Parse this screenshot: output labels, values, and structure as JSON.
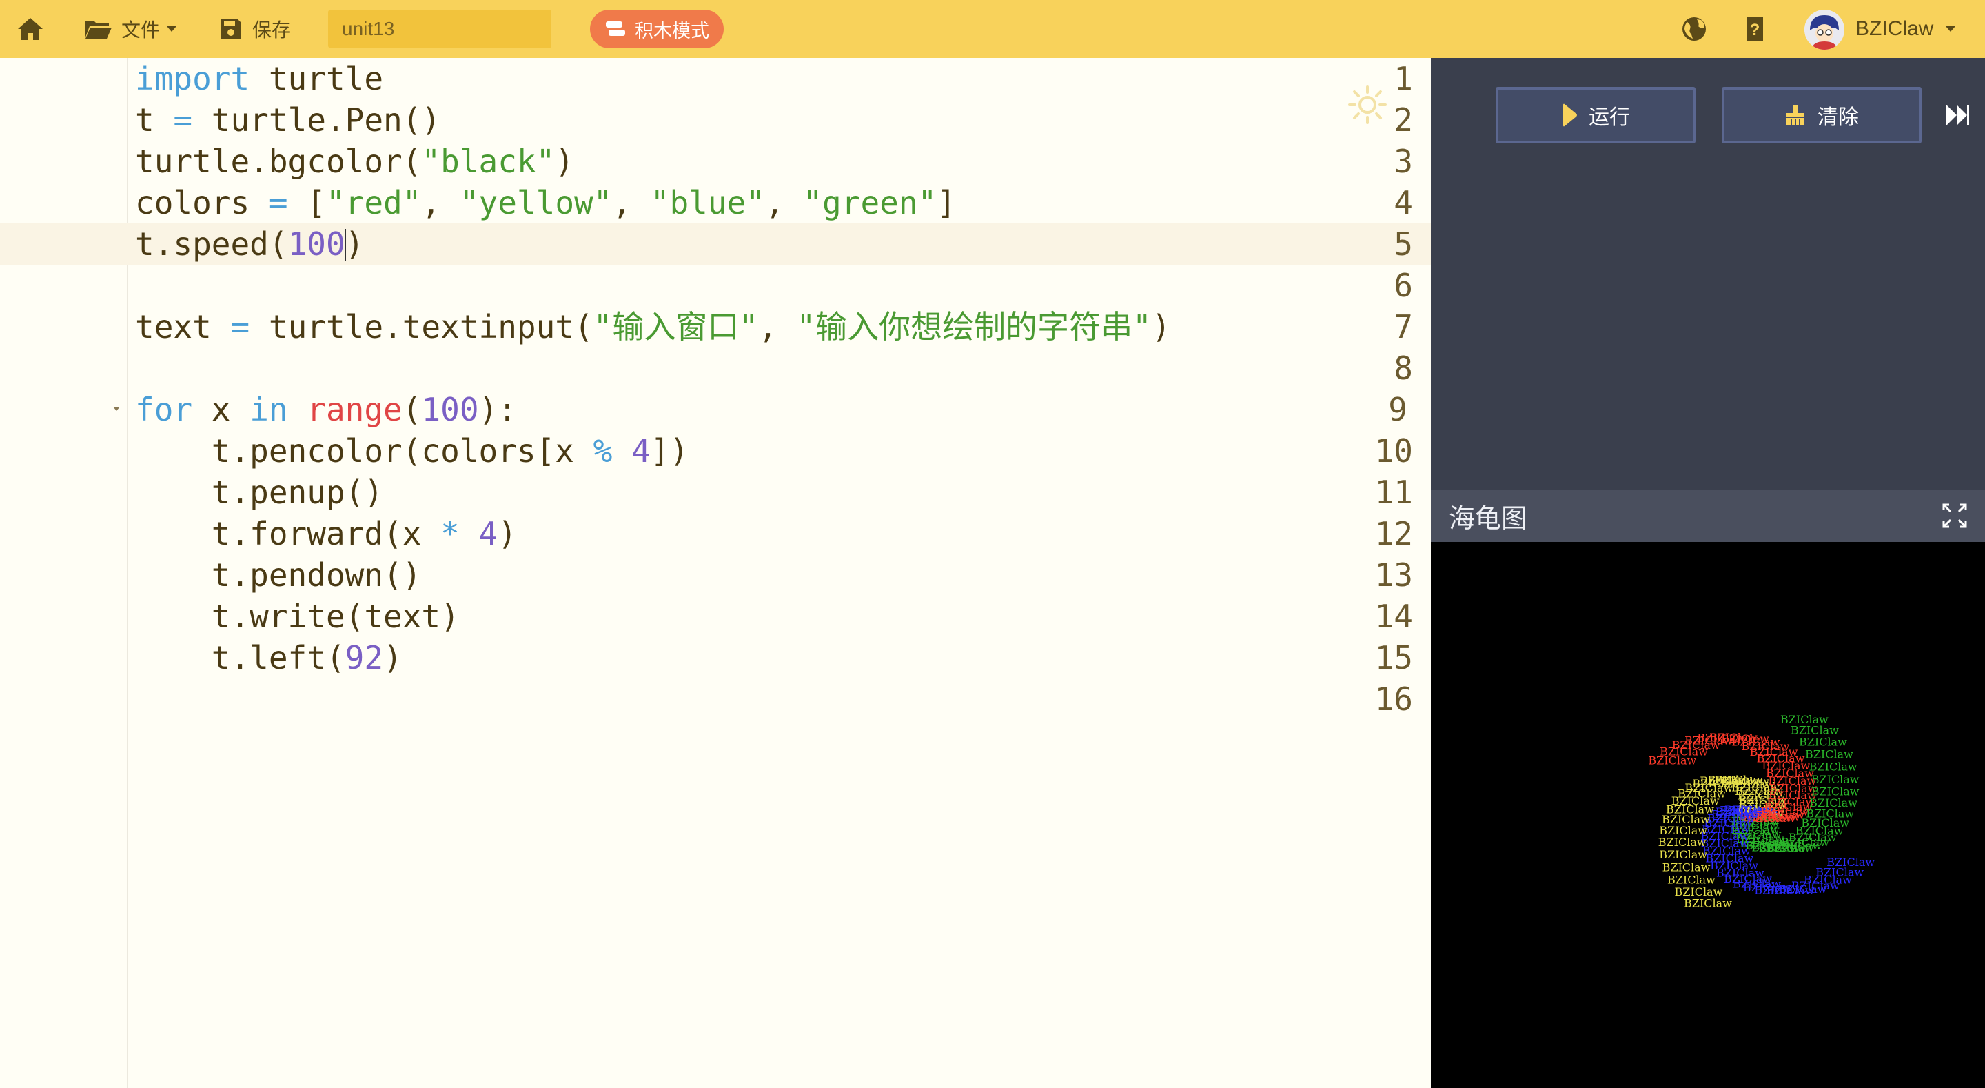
{
  "topbar": {
    "home_icon": "home-icon",
    "file_label": "文件",
    "save_label": "保存",
    "project_name": "unit13",
    "blocks_mode_label": "积木模式",
    "username": "BZIClaw",
    "bg_color": "#f8d25b"
  },
  "editor": {
    "theme_icon": "sun-icon",
    "active_line": 5,
    "lines": [
      {
        "n": "1"
      },
      {
        "n": "2"
      },
      {
        "n": "3"
      },
      {
        "n": "4"
      },
      {
        "n": "5"
      },
      {
        "n": "6"
      },
      {
        "n": "7"
      },
      {
        "n": "8"
      },
      {
        "n": "9"
      },
      {
        "n": "10"
      },
      {
        "n": "11"
      },
      {
        "n": "12"
      },
      {
        "n": "13"
      },
      {
        "n": "14"
      },
      {
        "n": "15"
      },
      {
        "n": "16"
      }
    ],
    "code": {
      "l1_kw": "import",
      "l1_rest": " turtle",
      "l2_a": "t ",
      "l2_op": "=",
      "l2_b": " turtle.Pen()",
      "l3_a": "turtle.bgcolor(",
      "l3_str": "\"black\"",
      "l3_b": ")",
      "l4_a": "colors ",
      "l4_op": "=",
      "l4_b": " [",
      "l4_s1": "\"red\"",
      "l4_c1": ", ",
      "l4_s2": "\"yellow\"",
      "l4_c2": ", ",
      "l4_s3": "\"blue\"",
      "l4_c3": ", ",
      "l4_s4": "\"green\"",
      "l4_e": "]",
      "l5_a": "t.speed(",
      "l5_num": "100",
      "l5_b": ")",
      "l7_a": "text ",
      "l7_op": "=",
      "l7_b": " turtle.textinput(",
      "l7_s1": "\"输入窗口\"",
      "l7_c": ", ",
      "l7_s2": "\"输入你想绘制的字符串\"",
      "l7_e": ")",
      "l9_kw1": "for",
      "l9_a": " x ",
      "l9_kw2": "in",
      "l9_b": " ",
      "l9_bi": "range",
      "l9_c": "(",
      "l9_num": "100",
      "l9_d": "):",
      "l10_a": "    t.pencolor(colors[x ",
      "l10_op": "%",
      "l10_b": " ",
      "l10_num": "4",
      "l10_c": "])",
      "l11": "    t.penup()",
      "l12_a": "    t.forward(x ",
      "l12_op": "*",
      "l12_b": " ",
      "l12_num": "4",
      "l12_c": ")",
      "l13": "    t.pendown()",
      "l14": "    t.write(text)",
      "l15_a": "    t.left(",
      "l15_num": "92",
      "l15_b": ")"
    }
  },
  "runner": {
    "run_label": "运行",
    "clear_label": "清除",
    "turtle_title": "海龟图",
    "panel_color": "#3a3f4d"
  },
  "turtle": {
    "text": "BZIClaw",
    "steps": 100,
    "step_length_factor": 4,
    "turn_degrees": 92,
    "colors": [
      "#ff3a2a",
      "#e8e04a",
      "#2a2aff",
      "#2bb82b"
    ]
  }
}
